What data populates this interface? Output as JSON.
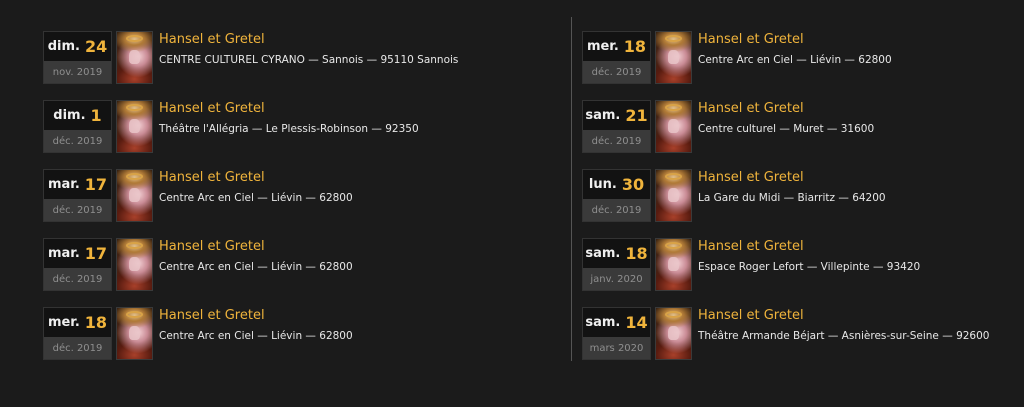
{
  "events": [
    {
      "weekday": "dim.",
      "day": "24",
      "monthyear": "nov. 2019",
      "title": "Hansel et Gretel",
      "venue": "CENTRE CULTUREL CYRANO — Sannois — 95110 Sannois"
    },
    {
      "weekday": "dim.",
      "day": "1",
      "monthyear": "déc. 2019",
      "title": "Hansel et Gretel",
      "venue": "Théâtre l'Allégria — Le Plessis-Robinson — 92350"
    },
    {
      "weekday": "mar.",
      "day": "17",
      "monthyear": "déc. 2019",
      "title": "Hansel et Gretel",
      "venue": "Centre Arc en Ciel — Liévin — 62800"
    },
    {
      "weekday": "mar.",
      "day": "17",
      "monthyear": "déc. 2019",
      "title": "Hansel et Gretel",
      "venue": "Centre Arc en Ciel — Liévin — 62800"
    },
    {
      "weekday": "mer.",
      "day": "18",
      "monthyear": "déc. 2019",
      "title": "Hansel et Gretel",
      "venue": "Centre Arc en Ciel — Liévin — 62800"
    },
    {
      "weekday": "mer.",
      "day": "18",
      "monthyear": "déc. 2019",
      "title": "Hansel et Gretel",
      "venue": "Centre Arc en Ciel — Liévin — 62800"
    },
    {
      "weekday": "sam.",
      "day": "21",
      "monthyear": "déc. 2019",
      "title": "Hansel et Gretel",
      "venue": "Centre culturel — Muret — 31600"
    },
    {
      "weekday": "lun.",
      "day": "30",
      "monthyear": "déc. 2019",
      "title": "Hansel et Gretel",
      "venue": "La Gare du Midi — Biarritz — 64200"
    },
    {
      "weekday": "sam.",
      "day": "18",
      "monthyear": "janv. 2020",
      "title": "Hansel et Gretel",
      "venue": "Espace Roger Lefort — Villepinte — 93420"
    },
    {
      "weekday": "sam.",
      "day": "14",
      "monthyear": "mars 2020",
      "title": "Hansel et Gretel",
      "venue": "Théâtre Armande Béjart — Asnières-sur-Seine — 92600"
    }
  ],
  "colors": {
    "background": "#1b1b1b",
    "accent": "#f0b43c",
    "date_top": "#121212",
    "date_bottom": "#3a3a3a",
    "divider": "#555555"
  }
}
